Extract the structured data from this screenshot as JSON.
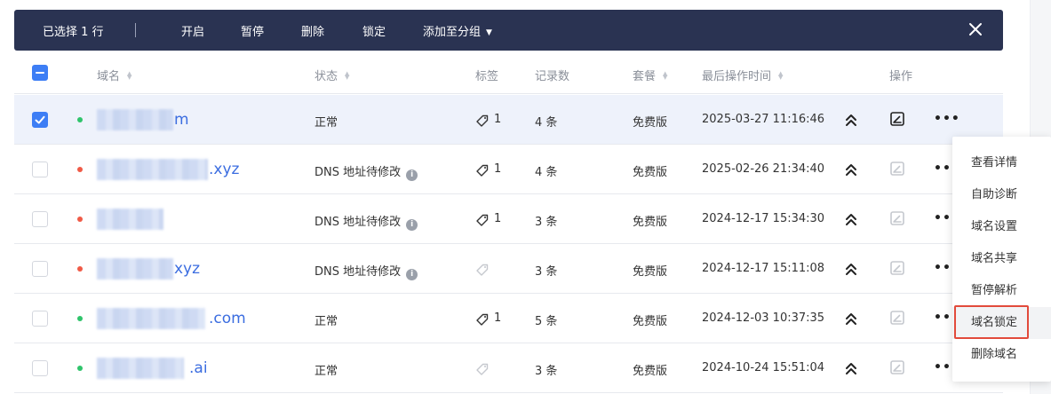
{
  "batch_bar": {
    "selected_text": "已选择 1 行",
    "actions": [
      "开启",
      "暂停",
      "删除",
      "锁定",
      "添加至分组"
    ],
    "dropdown_caret": "▼",
    "colors": {
      "bar_bg": "#2a3352",
      "text": "#ffffff"
    }
  },
  "table": {
    "headers": {
      "domain": "域名",
      "status": "状态",
      "tags": "标签",
      "records": "记录数",
      "plan": "套餐",
      "last_op": "最后操作时间",
      "actions": "操作"
    },
    "rows": [
      {
        "checked": true,
        "status_color": "#2fc46b",
        "domain_suffix": "m",
        "status": "正常",
        "has_info": false,
        "tag_count": "1",
        "records": "4 条",
        "plan": "免费版",
        "last_op": "2025-03-27 11:16:46",
        "edit_active": true
      },
      {
        "checked": false,
        "status_color": "#f05a46",
        "domain_suffix": ".xyz",
        "status": "DNS 地址待修改",
        "has_info": true,
        "tag_count": "1",
        "records": "4 条",
        "plan": "免费版",
        "last_op": "2025-02-26 21:34:40",
        "edit_active": false
      },
      {
        "checked": false,
        "status_color": "#f05a46",
        "domain_suffix": "",
        "status": "DNS 地址待修改",
        "has_info": true,
        "tag_count": "1",
        "records": "3 条",
        "plan": "免费版",
        "last_op": "2024-12-17 15:34:30",
        "edit_active": false
      },
      {
        "checked": false,
        "status_color": "#f05a46",
        "domain_suffix": "xyz",
        "status": "DNS 地址待修改",
        "has_info": true,
        "tag_count": "",
        "records": "3 条",
        "plan": "免费版",
        "last_op": "2024-12-17 15:11:08",
        "edit_active": false
      },
      {
        "checked": false,
        "status_color": "#2fc46b",
        "domain_suffix": ".com",
        "status": "正常",
        "has_info": false,
        "tag_count": "1",
        "records": "5 条",
        "plan": "免费版",
        "last_op": "2024-12-03 10:37:35",
        "edit_active": false
      },
      {
        "checked": false,
        "status_color": "#2fc46b",
        "domain_suffix": ".ai",
        "status": "正常",
        "has_info": false,
        "tag_count": "",
        "records": "3 条",
        "plan": "免费版",
        "last_op": "2024-10-24 15:51:04",
        "edit_active": false
      }
    ],
    "info_symbol": "i"
  },
  "context_menu": {
    "items": [
      "查看详情",
      "自助诊断",
      "域名设置",
      "域名共享",
      "暂停解析",
      "域名锁定",
      "删除域名"
    ],
    "highlighted": "域名锁定",
    "highlight_color": "#e24a3b"
  },
  "icons": {
    "close": "close-icon",
    "tag": "tag-icon",
    "collapse": "chevrons-up-icon",
    "edit": "edit-icon",
    "more": "more-icon",
    "info": "info-icon"
  },
  "more_glyph": "•••"
}
